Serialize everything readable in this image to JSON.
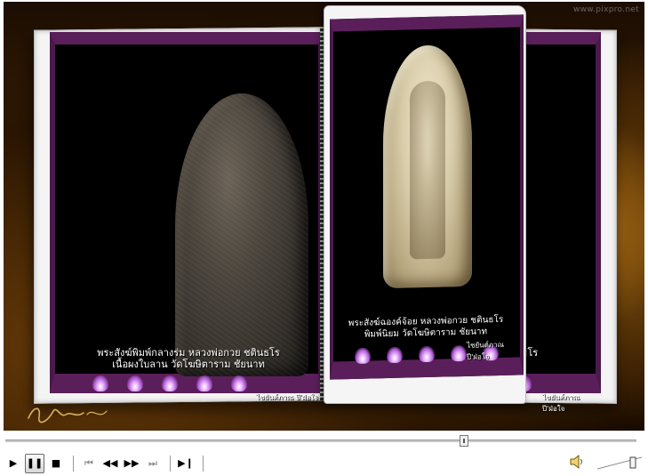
{
  "watermark": "www.pixpro.net",
  "pages": {
    "left": {
      "caption_line1": "พระสังฆ์พิมพ์กลางร่ม หลวงพ่อกวย ชตินธโร",
      "caption_line2": "เนื้อผงใบลาน วัดโฆษิตาราม ชัยนาท",
      "credit": "ไชยันต์ภาณ ปี'ฝ่อใจ"
    },
    "right": {
      "caption_line1": "พระสังฆ์ฉองค์จ้อย หลวงพ่อกวย ชตินธโร",
      "caption_line2": "พิมพ์นิยม วัดโฆษิตาราม ชัยนาท",
      "credit": "ไชยันต์ภาณ ปี'ฝ่อใจ"
    },
    "back": {
      "caption_fragment": "ตินธโร",
      "credit": "ไชยันต์ภาณ ปี'ฝ่อใจ"
    }
  },
  "player": {
    "seek_progress": 0.73,
    "volume_level": 0.85,
    "buttons": {
      "play": "▶",
      "pause": "❚❚",
      "stop": "■",
      "prev_track": "⏮",
      "rewind": "◀◀",
      "fast_forward": "▶▶",
      "next_track": "⏭",
      "step_frame": "▶❙"
    }
  },
  "colors": {
    "frame_purple": "#5a1f5a",
    "flame_glow": "#e9b8ff"
  }
}
